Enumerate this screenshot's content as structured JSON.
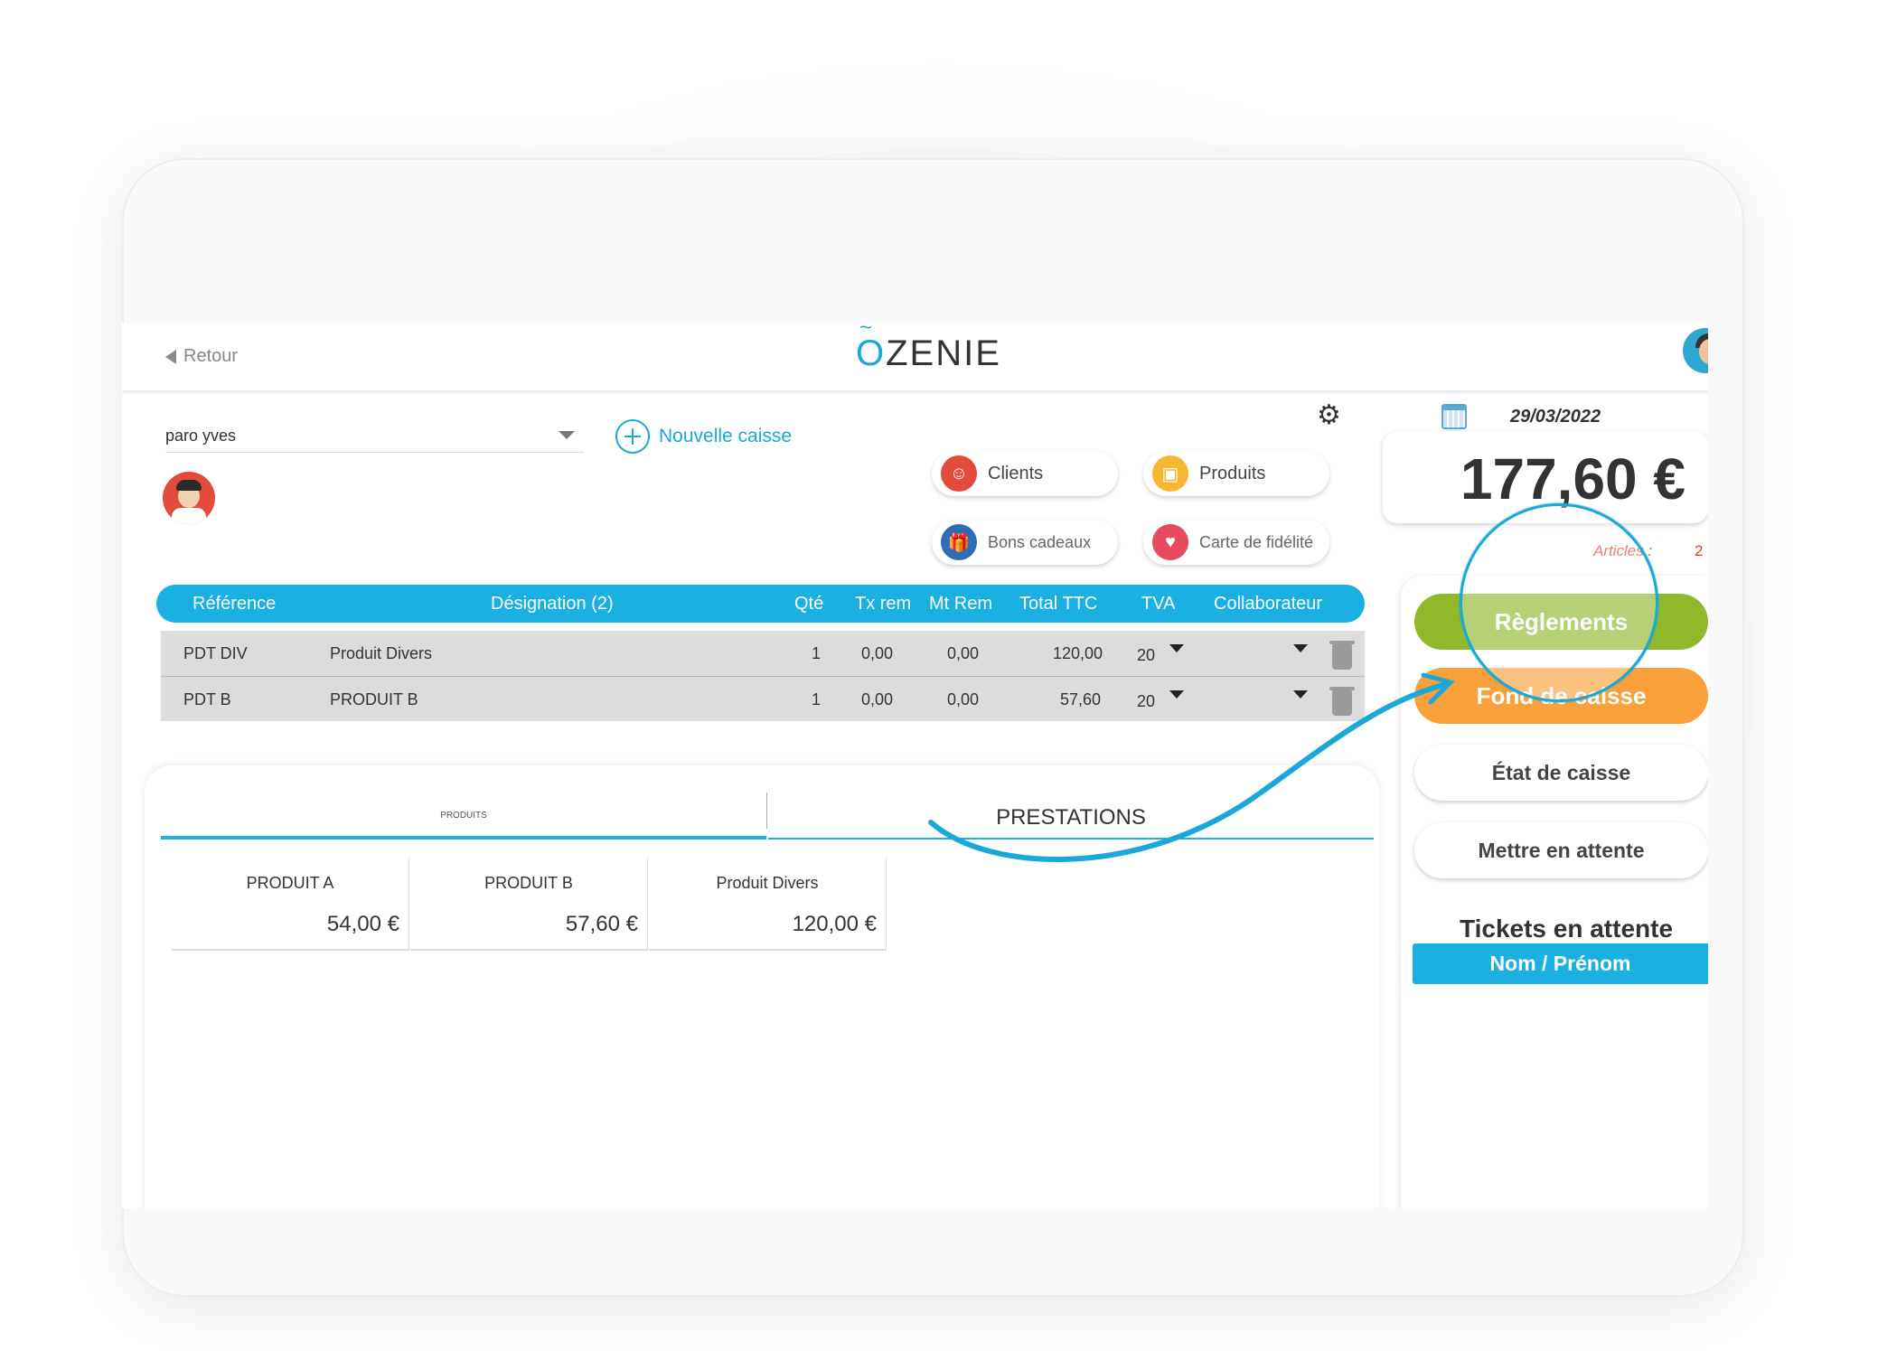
{
  "header": {
    "back_label": "Retour",
    "logo_text": "ZENIE",
    "logo_o": "O"
  },
  "staff": {
    "selected": "paro yves"
  },
  "actions": {
    "new_register": "Nouvelle caisse",
    "clients": "Clients",
    "products": "Produits",
    "gift_vouchers": "Bons cadeaux",
    "loyalty_card": "Carte de fidélité"
  },
  "table": {
    "headers": [
      "Référence",
      "Désignation (2)",
      "Qté",
      "Tx rem",
      "Mt Rem",
      "Total TTC",
      "TVA",
      "Collaborateur"
    ],
    "rows": [
      {
        "ref": "PDT DIV",
        "designation": "Produit Divers",
        "qty": "1",
        "tx_rem": "0,00",
        "mt_rem": "0,00",
        "total": "120,00",
        "tva": "20"
      },
      {
        "ref": "PDT B",
        "designation": "PRODUIT B",
        "qty": "1",
        "tx_rem": "0,00",
        "mt_rem": "0,00",
        "total": "57,60",
        "tva": "20"
      }
    ]
  },
  "catalog": {
    "tab_products": "PRODUITS",
    "tab_services": "PRESTATIONS",
    "items": [
      {
        "name": "PRODUIT A",
        "price": "54,00 €"
      },
      {
        "name": "PRODUIT B",
        "price": "57,60 €"
      },
      {
        "name": "Produit Divers",
        "price": "120,00 €"
      }
    ]
  },
  "summary": {
    "date": "29/03/2022",
    "total": "177,60 €",
    "articles_label": "Articles :",
    "articles_count": "2"
  },
  "buttons": {
    "payments": "Règlements",
    "cash_fund": "Fond de caisse",
    "cash_state": "État de caisse",
    "hold": "Mettre en attente"
  },
  "tickets": {
    "title": "Tickets en attente",
    "column": "Nom / Prénom"
  },
  "colors": {
    "accent": "#1bb0e2",
    "green": "#8fb92b",
    "orange": "#f9a03b",
    "alert": "#e53b2c"
  }
}
